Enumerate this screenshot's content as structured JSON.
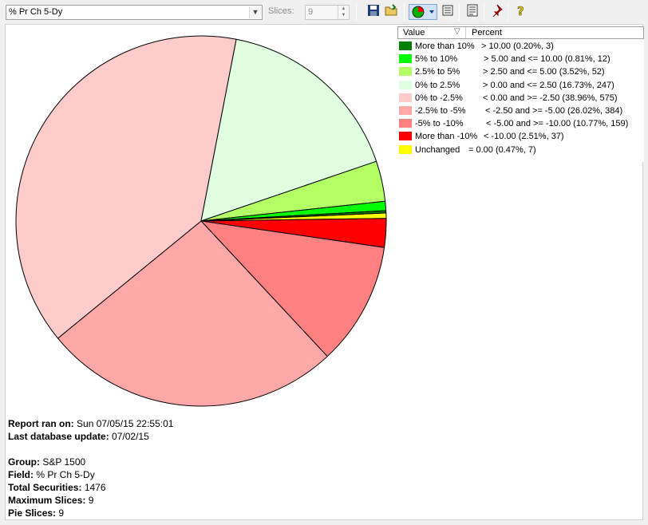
{
  "toolbar": {
    "field_value": "% Pr Ch 5-Dy",
    "slices_label": "Slices:",
    "slices_value": "9"
  },
  "legend": {
    "header_value": "Value",
    "header_percent": "Percent"
  },
  "chart_data": {
    "type": "pie",
    "slices": [
      {
        "label": "More than 10%",
        "range": "> 10.00 (0.20%, 3)",
        "percent": 0.2,
        "count": 3,
        "color": "#008000"
      },
      {
        "label": "5% to 10%",
        "range": "> 5.00 and <= 10.00 (0.81%, 12)",
        "percent": 0.81,
        "count": 12,
        "color": "#00ff00"
      },
      {
        "label": "2.5% to 5%",
        "range": "> 2.50 and <= 5.00 (3.52%, 52)",
        "percent": 3.52,
        "count": 52,
        "color": "#b3ff66"
      },
      {
        "label": "0% to 2.5%",
        "range": "> 0.00 and <= 2.50 (16.73%, 247)",
        "percent": 16.73,
        "count": 247,
        "color": "#e0ffe0"
      },
      {
        "label": "0% to -2.5%",
        "range": "< 0.00 and >= -2.50 (38.96%, 575)",
        "percent": 38.96,
        "count": 575,
        "color": "#ffcccc"
      },
      {
        "label": "-2.5% to -5%",
        "range": "< -2.50 and >= -5.00 (26.02%, 384)",
        "percent": 26.02,
        "count": 384,
        "color": "#ffa8a8"
      },
      {
        "label": "-5% to -10%",
        "range": "< -5.00 and >= -10.00 (10.77%, 159)",
        "percent": 10.77,
        "count": 159,
        "color": "#ff8080"
      },
      {
        "label": "More than -10%",
        "range": "< -10.00 (2.51%, 37)",
        "percent": 2.51,
        "count": 37,
        "color": "#ff0000"
      },
      {
        "label": "Unchanged",
        "range": "= 0.00 (0.47%, 7)",
        "percent": 0.47,
        "count": 7,
        "color": "#ffff00"
      }
    ]
  },
  "report": {
    "ran_label": "Report ran on:",
    "ran_value": "Sun 07/05/15 22:55:01",
    "update_label": "Last database update:",
    "update_value": "07/02/15",
    "group_label": "Group:",
    "group_value": "S&P 1500",
    "field_label": "Field:",
    "field_value": "% Pr Ch 5-Dy",
    "total_label": "Total Securities:",
    "total_value": "1476",
    "max_label": "Maximum Slices:",
    "max_value": "9",
    "pie_label": "Pie Slices:",
    "pie_value": "9"
  }
}
